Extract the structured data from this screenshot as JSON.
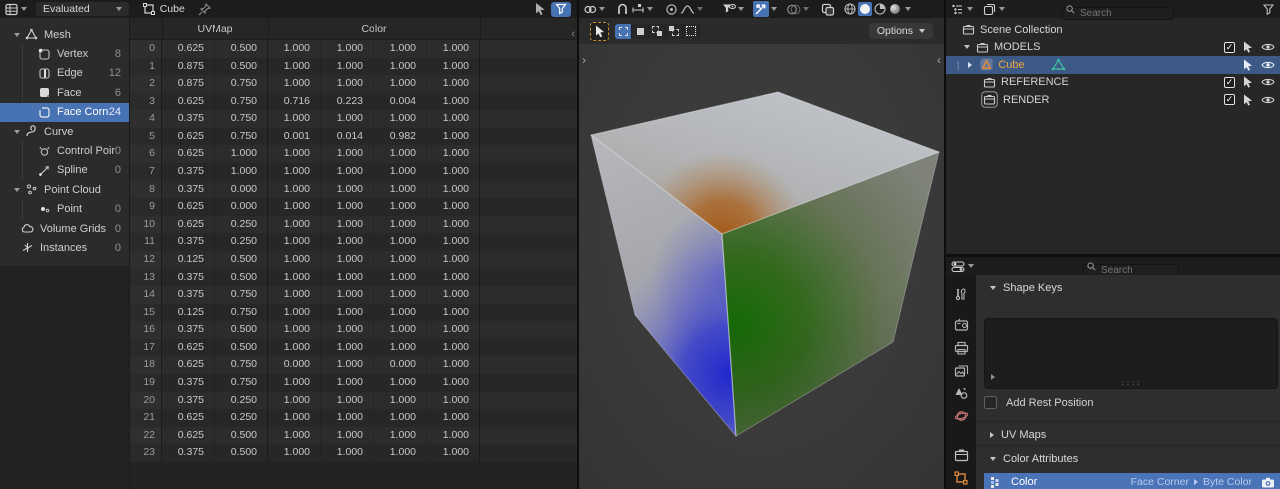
{
  "colors": {
    "accent": "#4772b3",
    "outliner_selection": "#3d5a87",
    "active_object_text": "#efa73e"
  },
  "spreadsheet": {
    "datasource_label": "Evaluated",
    "object_name": "Cube",
    "tree": [
      {
        "label": "Mesh"
      },
      {
        "label": "Vertex",
        "count": "8"
      },
      {
        "label": "Edge",
        "count": "12"
      },
      {
        "label": "Face",
        "count": "6"
      },
      {
        "label": "Face Corner",
        "count": "24"
      },
      {
        "label": "Curve"
      },
      {
        "label": "Control Point",
        "count": "0"
      },
      {
        "label": "Spline",
        "count": "0"
      },
      {
        "label": "Point Cloud"
      },
      {
        "label": "Point",
        "count": "0"
      },
      {
        "label": "Volume Grids",
        "count": "0"
      },
      {
        "label": "Instances",
        "count": "0"
      }
    ],
    "table": {
      "column_groups": [
        "UVMap",
        "Color"
      ],
      "rows": [
        [
          "0",
          "0.625",
          "0.500",
          "1.000",
          "1.000",
          "1.000",
          "1.000"
        ],
        [
          "1",
          "0.875",
          "0.500",
          "1.000",
          "1.000",
          "1.000",
          "1.000"
        ],
        [
          "2",
          "0.875",
          "0.750",
          "1.000",
          "1.000",
          "1.000",
          "1.000"
        ],
        [
          "3",
          "0.625",
          "0.750",
          "0.716",
          "0.223",
          "0.004",
          "1.000"
        ],
        [
          "4",
          "0.375",
          "0.750",
          "1.000",
          "1.000",
          "1.000",
          "1.000"
        ],
        [
          "5",
          "0.625",
          "0.750",
          "0.001",
          "0.014",
          "0.982",
          "1.000"
        ],
        [
          "6",
          "0.625",
          "1.000",
          "1.000",
          "1.000",
          "1.000",
          "1.000"
        ],
        [
          "7",
          "0.375",
          "1.000",
          "1.000",
          "1.000",
          "1.000",
          "1.000"
        ],
        [
          "8",
          "0.375",
          "0.000",
          "1.000",
          "1.000",
          "1.000",
          "1.000"
        ],
        [
          "9",
          "0.625",
          "0.000",
          "1.000",
          "1.000",
          "1.000",
          "1.000"
        ],
        [
          "10",
          "0.625",
          "0.250",
          "1.000",
          "1.000",
          "1.000",
          "1.000"
        ],
        [
          "11",
          "0.375",
          "0.250",
          "1.000",
          "1.000",
          "1.000",
          "1.000"
        ],
        [
          "12",
          "0.125",
          "0.500",
          "1.000",
          "1.000",
          "1.000",
          "1.000"
        ],
        [
          "13",
          "0.375",
          "0.500",
          "1.000",
          "1.000",
          "1.000",
          "1.000"
        ],
        [
          "14",
          "0.375",
          "0.750",
          "1.000",
          "1.000",
          "1.000",
          "1.000"
        ],
        [
          "15",
          "0.125",
          "0.750",
          "1.000",
          "1.000",
          "1.000",
          "1.000"
        ],
        [
          "16",
          "0.375",
          "0.500",
          "1.000",
          "1.000",
          "1.000",
          "1.000"
        ],
        [
          "17",
          "0.625",
          "0.500",
          "1.000",
          "1.000",
          "1.000",
          "1.000"
        ],
        [
          "18",
          "0.625",
          "0.750",
          "0.000",
          "1.000",
          "0.000",
          "1.000"
        ],
        [
          "19",
          "0.375",
          "0.750",
          "1.000",
          "1.000",
          "1.000",
          "1.000"
        ],
        [
          "20",
          "0.375",
          "0.250",
          "1.000",
          "1.000",
          "1.000",
          "1.000"
        ],
        [
          "21",
          "0.625",
          "0.250",
          "1.000",
          "1.000",
          "1.000",
          "1.000"
        ],
        [
          "22",
          "0.625",
          "0.500",
          "1.000",
          "1.000",
          "1.000",
          "1.000"
        ],
        [
          "23",
          "0.375",
          "0.500",
          "1.000",
          "1.000",
          "1.000",
          "1.000"
        ]
      ]
    }
  },
  "viewport": {
    "options_label": "Options"
  },
  "outliner": {
    "search_placeholder": "Search",
    "items": {
      "scene_collection": "Scene Collection",
      "models": "MODELS",
      "cube": "Cube",
      "reference": "REFERENCE",
      "render": "RENDER"
    }
  },
  "properties": {
    "search_placeholder": "Search",
    "shape_keys_label": "Shape Keys",
    "add_rest_position_label": "Add Rest Position",
    "uv_maps_label": "UV Maps",
    "color_attributes_label": "Color Attributes",
    "color_attr": {
      "name": "Color",
      "domain": "Face Corner",
      "type": "Byte Color"
    }
  }
}
